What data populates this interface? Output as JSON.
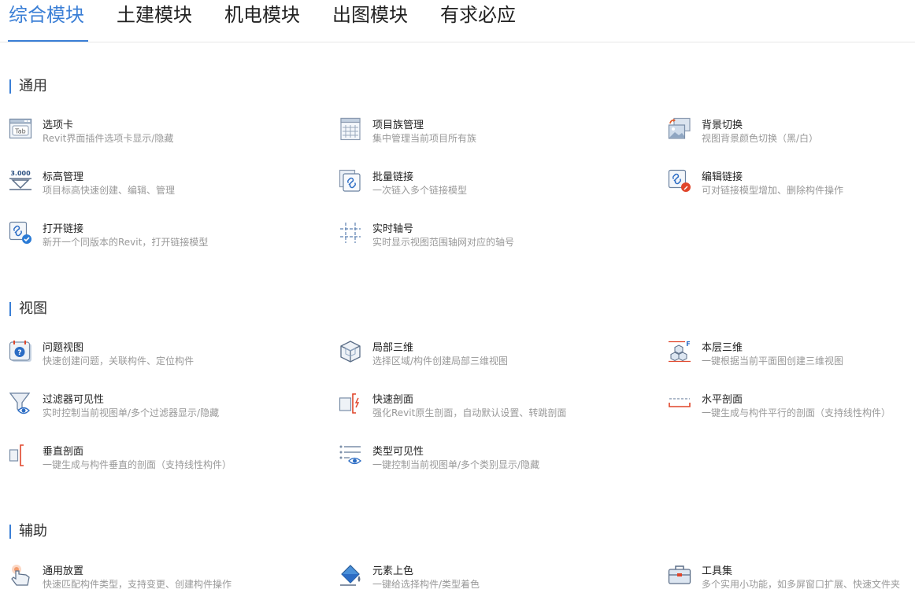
{
  "tabs": [
    "综合模块",
    "土建模块",
    "机电模块",
    "出图模块",
    "有求必应"
  ],
  "icons": {
    "tab_text": "Tab",
    "level_text": "3.000",
    "layer_text": "F"
  },
  "sections": [
    {
      "title": "通用",
      "items": [
        {
          "title": "选项卡",
          "desc": "Revit界面插件选项卡显示/隐藏",
          "icon": "tab-window-icon"
        },
        {
          "title": "项目族管理",
          "desc": "集中管理当前项目所有族",
          "icon": "table-grid-icon"
        },
        {
          "title": "背景切换",
          "desc": "视图背景颜色切换（黑/白）",
          "icon": "background-switch-icon"
        },
        {
          "title": "标高管理",
          "desc": "项目标高快速创建、编辑、管理",
          "icon": "level-marker-icon"
        },
        {
          "title": "批量链接",
          "desc": "一次链入多个链接模型",
          "icon": "batch-link-icon"
        },
        {
          "title": "编辑链接",
          "desc": "可对链接模型增加、删除构件操作",
          "icon": "edit-link-icon"
        },
        {
          "title": "打开链接",
          "desc": "新开一个同版本的Revit，打开链接模型",
          "icon": "open-link-icon"
        },
        {
          "title": "实时轴号",
          "desc": "实时显示视图范围轴网对应的轴号",
          "icon": "grid-axis-icon"
        }
      ]
    },
    {
      "title": "视图",
      "items": [
        {
          "title": "问题视图",
          "desc": "快速创建问题，关联构件、定位构件",
          "icon": "issue-view-icon"
        },
        {
          "title": "局部三维",
          "desc": "选择区域/构件创建局部三维视图",
          "icon": "local-3d-cube-icon"
        },
        {
          "title": "本层三维",
          "desc": "一键根据当前平面图创建三维视图",
          "icon": "floor-3d-icon"
        },
        {
          "title": "过滤器可见性",
          "desc": "实时控制当前视图单/多个过滤器显示/隐藏",
          "icon": "filter-visibility-icon"
        },
        {
          "title": "快速剖面",
          "desc": "强化Revit原生剖面，自动默认设置、转跳剖面",
          "icon": "quick-section-icon"
        },
        {
          "title": "水平剖面",
          "desc": "一键生成与构件平行的剖面（支持线性构件）",
          "icon": "horizontal-section-icon"
        },
        {
          "title": "垂直剖面",
          "desc": "一键生成与构件垂直的剖面（支持线性构件）",
          "icon": "vertical-section-icon"
        },
        {
          "title": "类型可见性",
          "desc": "一键控制当前视图单/多个类别显示/隐藏",
          "icon": "type-visibility-icon"
        }
      ]
    },
    {
      "title": "辅助",
      "items": [
        {
          "title": "通用放置",
          "desc": "快速匹配构件类型，支持变更、创建构件操作",
          "icon": "hand-place-icon"
        },
        {
          "title": "元素上色",
          "desc": "一键给选择构件/类型着色",
          "icon": "paint-bucket-icon"
        },
        {
          "title": "工具集",
          "desc": "多个实用小功能，如多屏窗口扩展、快速文件夹",
          "icon": "toolbox-icon"
        }
      ]
    }
  ]
}
